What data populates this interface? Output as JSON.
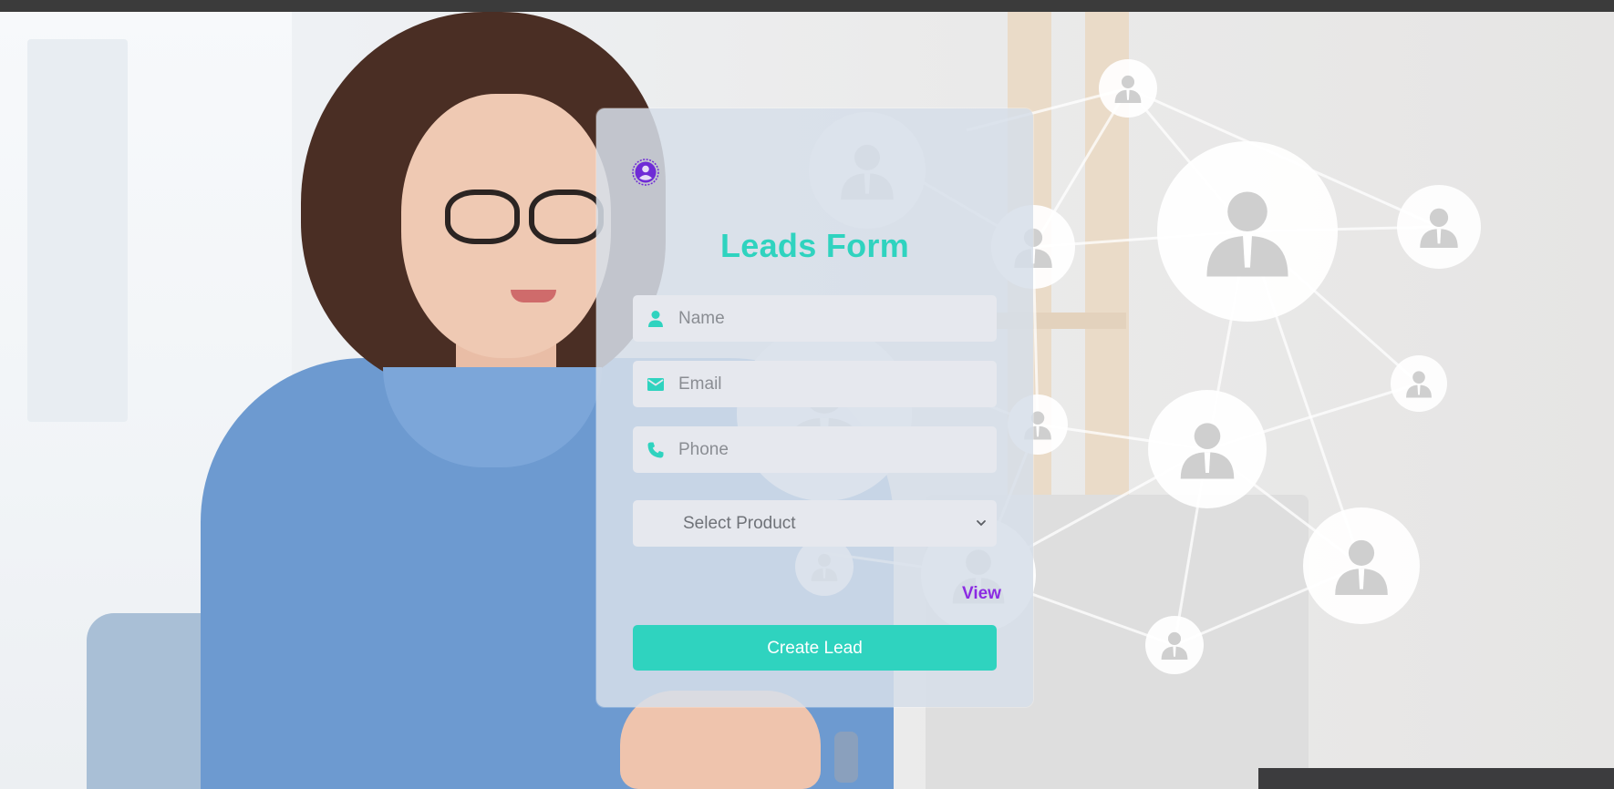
{
  "form": {
    "title": "Leads Form",
    "name_placeholder": "Name",
    "email_placeholder": "Email",
    "phone_placeholder": "Phone",
    "product_select": "Select Product",
    "view_link": "View",
    "submit_label": "Create Lead"
  },
  "icons": {
    "logo": "user-circle-icon",
    "name": "person-icon",
    "email": "envelope-icon",
    "phone": "phone-icon",
    "select": "chevron-down-icon"
  },
  "colors": {
    "accent": "#2fd3bf",
    "link": "#8b2be2",
    "logo": "#6f2bd6",
    "card": "#d6dee9",
    "input": "#e6e8ee",
    "topbar": "#3b3b3b"
  }
}
